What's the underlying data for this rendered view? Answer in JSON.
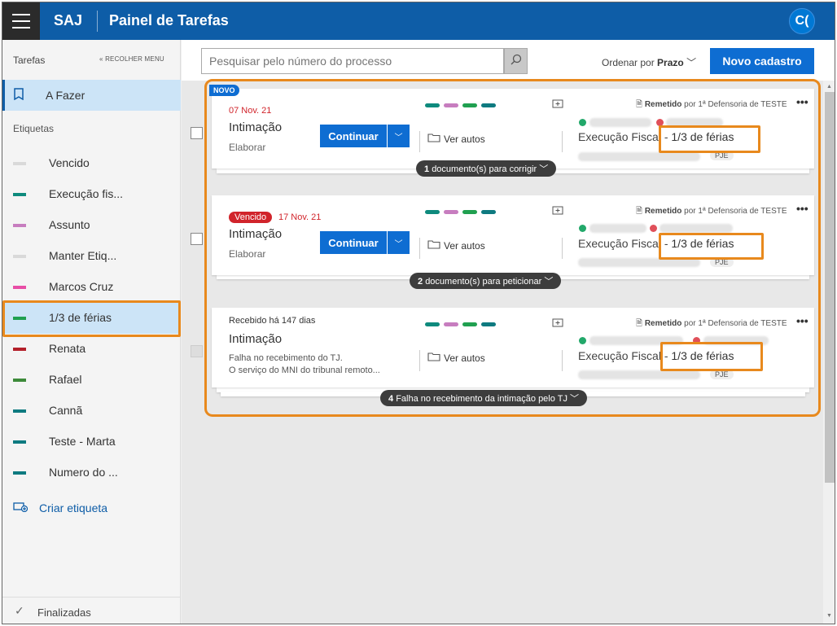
{
  "header": {
    "brand": "SAJ",
    "title": "Painel de Tarefas",
    "avatar": "C("
  },
  "sidebar": {
    "section_tasks": "Tarefas",
    "collapse_label": "« RECOLHER MENU",
    "todo_label": "A Fazer",
    "labels_section": "Etiquetas",
    "tags": [
      {
        "label": "Vencido",
        "color": "#d9d9d9"
      },
      {
        "label": "Execução fis...",
        "color": "#0e8a7d"
      },
      {
        "label": "Assunto",
        "color": "#c77dbf"
      },
      {
        "label": "Manter Etiq...",
        "color": "#d9d9d9"
      },
      {
        "label": "Marcos Cruz",
        "color": "#e84ea6"
      },
      {
        "label": "1/3 de férias",
        "color": "#20a050"
      },
      {
        "label": "Renata",
        "color": "#b3202a"
      },
      {
        "label": "Rafael",
        "color": "#3d8a3a"
      },
      {
        "label": "Cannã",
        "color": "#0e7a80"
      },
      {
        "label": "Teste - Marta",
        "color": "#0e7a80"
      },
      {
        "label": "Numero do ...",
        "color": "#0e7a80"
      }
    ],
    "create_label": "Criar etiqueta",
    "finished_label": "Finalizadas"
  },
  "toolbar": {
    "search_placeholder": "Pesquisar pelo número do processo",
    "order_label": "Ordenar por",
    "order_value": "Prazo",
    "new_button": "Novo cadastro"
  },
  "cards": [
    {
      "badge": "NOVO",
      "date": "07 Nov. 21",
      "title": "Intimação",
      "subtitle": "Elaborar",
      "continue_label": "Continuar",
      "view_label": "Ver autos",
      "remetido": "Remetido",
      "remetido_by": "por 1ª Defensoria de TESTE",
      "process_type": "Execução Fiscal",
      "process_tag": "1/3 de férias",
      "pje": "PJE",
      "pill_count": "1",
      "pill_text": "documento(s) para corrigir"
    },
    {
      "status": "Vencido",
      "date": "17 Nov. 21",
      "title": "Intimação",
      "subtitle": "Elaborar",
      "continue_label": "Continuar",
      "view_label": "Ver autos",
      "remetido": "Remetido",
      "remetido_by": "por 1ª Defensoria de TESTE",
      "process_type": "Execução Fiscal",
      "process_tag": "1/3 de férias",
      "pje": "PJE",
      "pill_count": "2",
      "pill_text": "documento(s) para peticionar"
    },
    {
      "received": "Recebido há 147 dias",
      "title": "Intimação",
      "message_line1": "Falha no recebimento do TJ.",
      "message_line2": "O serviço do MNI do tribunal remoto...",
      "view_label": "Ver autos",
      "remetido": "Remetido",
      "remetido_by": "por 1ª Defensoria de TESTE",
      "process_type": "Execução Fiscal",
      "process_tag": "1/3 de férias",
      "pje": "PJE",
      "pill_count": "4",
      "pill_text": "Falha no recebimento da intimação pelo TJ"
    }
  ],
  "card_colors": [
    "#0e8a7d",
    "#c77dbf",
    "#20a050",
    "#0e7a80"
  ],
  "accent_color": "#0e5da7",
  "highlight_color": "#e8891d"
}
